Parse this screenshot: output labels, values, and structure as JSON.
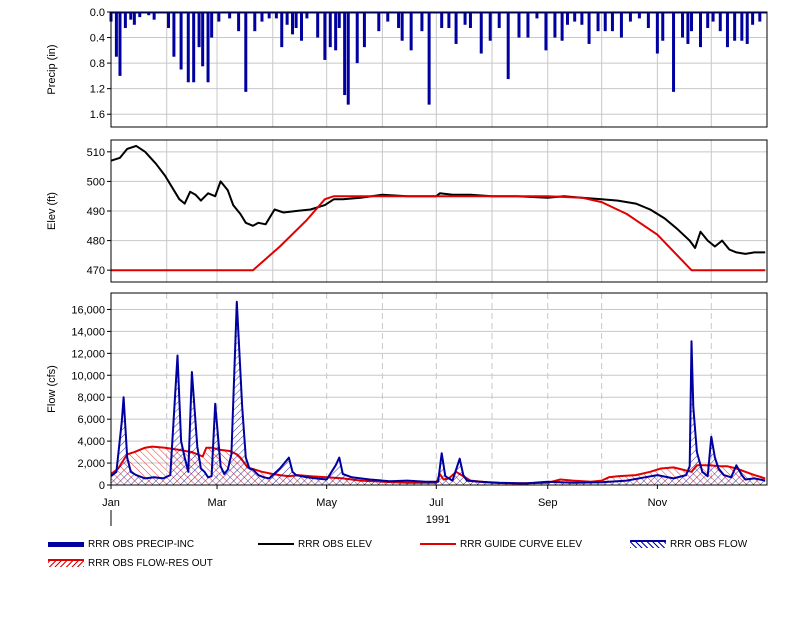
{
  "chart_data": [
    {
      "type": "bar",
      "panel": "precip",
      "ylabel": "Precip (in)",
      "ylim": [
        0.0,
        1.8
      ],
      "y_inverted": true,
      "y_ticks": [
        "0.0",
        "0.4",
        "0.8",
        "1.2",
        "1.6"
      ],
      "grid": true,
      "series": [
        {
          "name": "RRR OBS PRECIP-INC",
          "color": "#0000a0",
          "x": [
            "1991-01-01",
            "1991-01-04",
            "1991-01-06",
            "1991-01-09",
            "1991-01-12",
            "1991-01-14",
            "1991-01-17",
            "1991-01-22",
            "1991-01-25",
            "1991-02-02",
            "1991-02-05",
            "1991-02-09",
            "1991-02-13",
            "1991-02-16",
            "1991-02-19",
            "1991-02-21",
            "1991-02-24",
            "1991-02-26",
            "1991-03-02",
            "1991-03-08",
            "1991-03-13",
            "1991-03-17",
            "1991-03-22",
            "1991-03-26",
            "1991-03-30",
            "1991-04-03",
            "1991-04-06",
            "1991-04-09",
            "1991-04-12",
            "1991-04-14",
            "1991-04-17",
            "1991-04-20",
            "1991-04-26",
            "1991-04-30",
            "1991-05-03",
            "1991-05-06",
            "1991-05-08",
            "1991-05-11",
            "1991-05-13",
            "1991-05-18",
            "1991-05-22",
            "1991-05-30",
            "1991-06-04",
            "1991-06-10",
            "1991-06-12",
            "1991-06-17",
            "1991-06-23",
            "1991-06-27",
            "1991-07-04",
            "1991-07-08",
            "1991-07-12",
            "1991-07-17",
            "1991-07-20",
            "1991-07-26",
            "1991-07-31",
            "1991-08-05",
            "1991-08-10",
            "1991-08-16",
            "1991-08-21",
            "1991-08-26",
            "1991-08-31",
            "1991-09-05",
            "1991-09-09",
            "1991-09-12",
            "1991-09-16",
            "1991-09-20",
            "1991-09-24",
            "1991-09-29",
            "1991-10-03",
            "1991-10-07",
            "1991-10-12",
            "1991-10-17",
            "1991-10-22",
            "1991-10-27",
            "1991-11-01",
            "1991-11-04",
            "1991-11-10",
            "1991-11-15",
            "1991-11-18",
            "1991-11-20",
            "1991-11-25",
            "1991-11-29",
            "1991-12-02",
            "1991-12-06",
            "1991-12-10",
            "1991-12-14",
            "1991-12-18",
            "1991-12-21",
            "1991-12-24",
            "1991-12-28"
          ],
          "values": [
            0.15,
            0.7,
            1.0,
            0.25,
            0.12,
            0.2,
            0.08,
            0.05,
            0.12,
            0.25,
            0.7,
            0.9,
            1.1,
            1.1,
            0.55,
            0.85,
            1.1,
            0.4,
            0.15,
            0.1,
            0.3,
            1.25,
            0.3,
            0.15,
            0.1,
            0.1,
            0.55,
            0.2,
            0.35,
            0.25,
            0.45,
            0.1,
            0.4,
            0.75,
            0.55,
            0.6,
            0.25,
            1.3,
            1.45,
            0.8,
            0.55,
            0.3,
            0.15,
            0.25,
            0.45,
            0.6,
            0.3,
            1.45,
            0.25,
            0.25,
            0.5,
            0.2,
            0.25,
            0.65,
            0.45,
            0.25,
            1.05,
            0.4,
            0.4,
            0.1,
            0.6,
            0.4,
            0.45,
            0.2,
            0.15,
            0.2,
            0.5,
            0.3,
            0.3,
            0.3,
            0.4,
            0.15,
            0.1,
            0.25,
            0.65,
            0.45,
            1.25,
            0.4,
            0.5,
            0.3,
            0.55,
            0.25,
            0.15,
            0.3,
            0.55,
            0.45,
            0.45,
            0.5,
            0.2,
            0.15
          ]
        }
      ]
    },
    {
      "type": "line",
      "panel": "elev",
      "ylabel": "Elev (ft)",
      "ylim": [
        466,
        514
      ],
      "y_ticks": [
        "470",
        "480",
        "490",
        "500",
        "510"
      ],
      "grid": true,
      "series": [
        {
          "name": "RRR OBS ELEV",
          "color": "#000000",
          "x": [
            "1991-01-01",
            "1991-01-06",
            "1991-01-10",
            "1991-01-15",
            "1991-01-20",
            "1991-01-26",
            "1991-01-31",
            "1991-02-04",
            "1991-02-08",
            "1991-02-11",
            "1991-02-14",
            "1991-02-17",
            "1991-02-20",
            "1991-02-24",
            "1991-02-28",
            "1991-03-03",
            "1991-03-07",
            "1991-03-10",
            "1991-03-14",
            "1991-03-17",
            "1991-03-21",
            "1991-03-24",
            "1991-03-28",
            "1991-04-02",
            "1991-04-07",
            "1991-04-14",
            "1991-04-22",
            "1991-04-30",
            "1991-05-05",
            "1991-05-10",
            "1991-05-20",
            "1991-06-01",
            "1991-06-15",
            "1991-07-01",
            "1991-07-03",
            "1991-07-10",
            "1991-07-20",
            "1991-08-01",
            "1991-08-15",
            "1991-09-01",
            "1991-09-10",
            "1991-09-20",
            "1991-10-01",
            "1991-10-10",
            "1991-10-20",
            "1991-10-28",
            "1991-11-05",
            "1991-11-12",
            "1991-11-19",
            "1991-11-22",
            "1991-11-25",
            "1991-11-29",
            "1991-12-03",
            "1991-12-07",
            "1991-12-11",
            "1991-12-15",
            "1991-12-20",
            "1991-12-25",
            "1991-12-31"
          ],
          "values": [
            507,
            508,
            511,
            512,
            510,
            506,
            502,
            498,
            494,
            492.5,
            496.5,
            495.5,
            493.5,
            496,
            495,
            500,
            497,
            492,
            489,
            486,
            485,
            486,
            485.5,
            490.5,
            489.5,
            490,
            490.5,
            492,
            494,
            494,
            494.5,
            495.5,
            495,
            495,
            496,
            495.5,
            495.5,
            495,
            495,
            494.5,
            495,
            494.5,
            494,
            493.5,
            492.5,
            490.5,
            487.5,
            484,
            480,
            477.5,
            483,
            480,
            478,
            480,
            477,
            476,
            475.5,
            476,
            476
          ]
        },
        {
          "name": "RRR GUIDE CURVE ELEV",
          "color": "#e00000",
          "x": [
            "1991-01-01",
            "1991-03-21",
            "1991-04-05",
            "1991-04-20",
            "1991-04-30",
            "1991-05-05",
            "1991-09-01",
            "1991-09-20",
            "1991-10-01",
            "1991-10-15",
            "1991-11-01",
            "1991-11-20",
            "1991-12-31"
          ],
          "values": [
            470,
            470,
            478,
            487,
            494,
            495,
            495,
            494.5,
            493,
            489,
            482,
            470,
            470
          ]
        }
      ]
    },
    {
      "type": "area",
      "panel": "flow",
      "ylabel": "Flow (cfs)",
      "ylim": [
        0,
        17500
      ],
      "y_ticks": [
        "0",
        "2,000",
        "4,000",
        "6,000",
        "8,000",
        "10,000",
        "12,000",
        "14,000",
        "16,000"
      ],
      "x_ticks": [
        "Jan",
        "Mar",
        "May",
        "Jul",
        "Sep",
        "Nov"
      ],
      "x_label": "1991",
      "grid": true,
      "series": [
        {
          "name": "RRR OBS FLOW",
          "color": "#0000a0",
          "x": [
            "1991-01-01",
            "1991-01-04",
            "1991-01-07",
            "1991-01-08",
            "1991-01-10",
            "1991-01-12",
            "1991-01-15",
            "1991-01-20",
            "1991-01-25",
            "1991-01-30",
            "1991-02-03",
            "1991-02-07",
            "1991-02-09",
            "1991-02-11",
            "1991-02-13",
            "1991-02-15",
            "1991-02-18",
            "1991-02-20",
            "1991-02-22",
            "1991-02-24",
            "1991-02-26",
            "1991-02-28",
            "1991-03-03",
            "1991-03-05",
            "1991-03-07",
            "1991-03-09",
            "1991-03-12",
            "1991-03-15",
            "1991-03-17",
            "1991-03-19",
            "1991-03-21",
            "1991-03-24",
            "1991-03-27",
            "1991-03-30",
            "1991-04-05",
            "1991-04-10",
            "1991-04-12",
            "1991-04-14",
            "1991-04-20",
            "1991-04-25",
            "1991-05-01",
            "1991-05-06",
            "1991-05-08",
            "1991-05-10",
            "1991-05-15",
            "1991-05-25",
            "1991-06-05",
            "1991-06-15",
            "1991-06-25",
            "1991-07-02",
            "1991-07-04",
            "1991-07-06",
            "1991-07-10",
            "1991-07-14",
            "1991-07-16",
            "1991-07-18",
            "1991-07-25",
            "1991-08-05",
            "1991-08-20",
            "1991-09-01",
            "1991-09-15",
            "1991-10-01",
            "1991-10-15",
            "1991-10-25",
            "1991-11-01",
            "1991-11-10",
            "1991-11-17",
            "1991-11-19",
            "1991-11-20",
            "1991-11-21",
            "1991-11-23",
            "1991-11-26",
            "1991-11-29",
            "1991-12-01",
            "1991-12-03",
            "1991-12-05",
            "1991-12-08",
            "1991-12-12",
            "1991-12-15",
            "1991-12-18",
            "1991-12-20",
            "1991-12-25",
            "1991-12-31"
          ],
          "values": [
            800,
            1200,
            5800,
            8000,
            2500,
            1200,
            900,
            600,
            700,
            600,
            900,
            11800,
            4000,
            2500,
            1200,
            10300,
            3500,
            1500,
            1200,
            700,
            800,
            7400,
            1700,
            1000,
            1400,
            2800,
            16700,
            7100,
            2500,
            1500,
            1400,
            900,
            700,
            600,
            1500,
            2500,
            1200,
            900,
            700,
            600,
            500,
            1800,
            2500,
            1000,
            700,
            500,
            350,
            400,
            300,
            300,
            2900,
            800,
            400,
            2400,
            900,
            400,
            300,
            200,
            150,
            300,
            200,
            250,
            400,
            700,
            900,
            600,
            900,
            1700,
            13100,
            7100,
            3000,
            1200,
            800,
            4400,
            2500,
            1500,
            900,
            700,
            1800,
            900,
            500,
            600,
            400
          ]
        },
        {
          "name": "RRR OBS FLOW-RES OUT",
          "color": "#e00000",
          "x": [
            "1991-01-01",
            "1991-01-05",
            "1991-01-10",
            "1991-01-14",
            "1991-01-20",
            "1991-01-24",
            "1991-01-31",
            "1991-02-08",
            "1991-02-15",
            "1991-02-21",
            "1991-02-23",
            "1991-02-26",
            "1991-03-03",
            "1991-03-08",
            "1991-03-12",
            "1991-03-14",
            "1991-03-18",
            "1991-03-22",
            "1991-03-26",
            "1991-04-01",
            "1991-04-05",
            "1991-04-10",
            "1991-04-15",
            "1991-04-22",
            "1991-05-01",
            "1991-05-10",
            "1991-05-20",
            "1991-06-01",
            "1991-06-15",
            "1991-07-01",
            "1991-07-03",
            "1991-07-05",
            "1991-07-08",
            "1991-07-12",
            "1991-07-20",
            "1991-08-01",
            "1991-08-15",
            "1991-09-01",
            "1991-09-08",
            "1991-09-15",
            "1991-09-25",
            "1991-10-01",
            "1991-10-05",
            "1991-10-10",
            "1991-10-20",
            "1991-10-28",
            "1991-11-03",
            "1991-11-10",
            "1991-11-15",
            "1991-11-20",
            "1991-11-23",
            "1991-11-30",
            "1991-12-06",
            "1991-12-10",
            "1991-12-15",
            "1991-12-20",
            "1991-12-25",
            "1991-12-31"
          ],
          "values": [
            1000,
            1500,
            2800,
            3000,
            3400,
            3500,
            3400,
            3200,
            3000,
            2600,
            3400,
            3400,
            3200,
            3100,
            2800,
            2500,
            1600,
            1400,
            1200,
            1000,
            900,
            800,
            900,
            800,
            700,
            600,
            400,
            300,
            200,
            200,
            1000,
            500,
            600,
            1200,
            400,
            200,
            150,
            200,
            500,
            400,
            300,
            400,
            700,
            800,
            900,
            1200,
            1500,
            1600,
            1400,
            1200,
            1800,
            1800,
            1700,
            1700,
            1500,
            1200,
            900,
            600
          ]
        }
      ]
    }
  ],
  "legend": [
    {
      "label": "RRR OBS PRECIP-INC",
      "style": "bar",
      "color": "#0000a0"
    },
    {
      "label": "RRR OBS ELEV",
      "style": "line",
      "color": "#000000"
    },
    {
      "label": "RRR GUIDE CURVE ELEV",
      "style": "line",
      "color": "#e00000"
    },
    {
      "label": "RRR OBS FLOW",
      "style": "hatch",
      "color": "#0000a0"
    },
    {
      "label": "RRR OBS FLOW-RES OUT",
      "style": "hatch",
      "color": "#e00000"
    }
  ],
  "colors": {
    "grid": "#c8c8c8",
    "frame": "#000000"
  }
}
